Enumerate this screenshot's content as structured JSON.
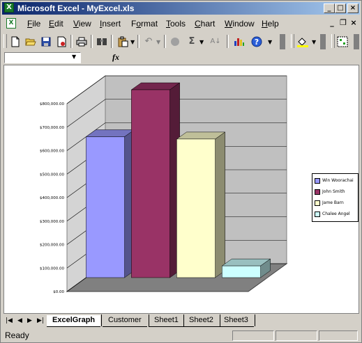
{
  "window": {
    "title": "Microsoft Excel - MyExcel.xls",
    "app_icon": "X"
  },
  "menu": {
    "items": [
      "File",
      "Edit",
      "View",
      "Insert",
      "Format",
      "Tools",
      "Chart",
      "Window",
      "Help"
    ],
    "underline": [
      "F",
      "E",
      "V",
      "I",
      "o",
      "T",
      "C",
      "W",
      "H"
    ]
  },
  "toolbar": {
    "icons": [
      "new-icon",
      "open-icon",
      "save-icon",
      "permission-icon",
      "print-icon",
      "research-icon",
      "paste-icon",
      "undo-icon",
      "hyperlink-icon",
      "autosum-icon",
      "sort-icon",
      "chart-wizard-icon",
      "help-icon",
      "fill-color-icon",
      "chart-type-icon"
    ],
    "autosum_glyph": "Σ"
  },
  "formula_bar": {
    "fx_label": "fx",
    "name_box": ""
  },
  "chart_data": {
    "type": "bar",
    "categories": [
      "Win Woorachai",
      "John Smith",
      "Jame Barn",
      "Chalee Angel"
    ],
    "values": [
      600000,
      800000,
      590000,
      50000
    ],
    "ylim": [
      0,
      800000
    ],
    "yticks": [
      "$0.00",
      "$100,000.00",
      "$200,000.00",
      "$300,000.00",
      "$400,000.00",
      "$500,000.00",
      "$600,000.00",
      "$700,000.00",
      "$800,000.00"
    ],
    "legend": [
      "Win Woorachai",
      "John Smith",
      "Jame Barn",
      "Chalee Angel"
    ],
    "legend_position": "right",
    "colors": [
      "#9999ff",
      "#993366",
      "#ffffcc",
      "#ccffff"
    ],
    "style": "3d-column"
  },
  "sheet_tabs": [
    "ExcelGraph",
    "Customer",
    "Sheet1",
    "Sheet2",
    "Sheet3"
  ],
  "active_tab": "ExcelGraph",
  "status": {
    "text": "Ready"
  }
}
